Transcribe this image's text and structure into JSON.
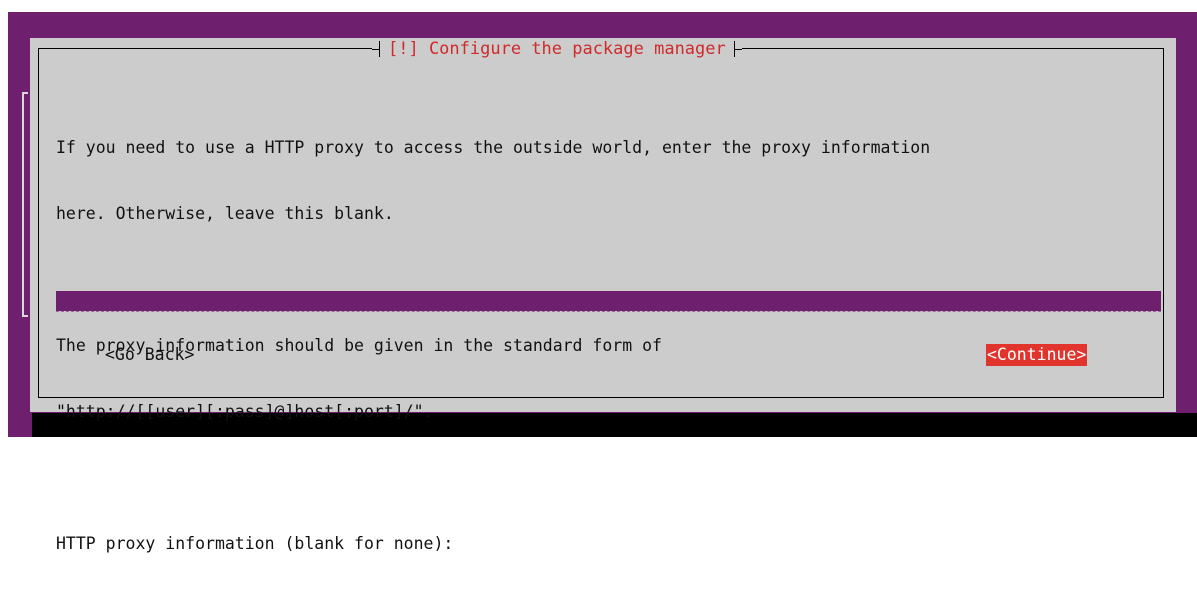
{
  "dialog": {
    "title": "[!] Configure the package manager",
    "paragraph1_line1": "If you need to use a HTTP proxy to access the outside world, enter the proxy information",
    "paragraph1_line2": "here. Otherwise, leave this blank.",
    "paragraph2_line1": "The proxy information should be given in the standard form of",
    "paragraph2_line2": "\"http://[[user][:pass]@]host[:port]/\".",
    "prompt": "HTTP proxy information (blank for none):",
    "proxy_value": ""
  },
  "buttons": {
    "back_label": "<Go Back>",
    "continue_label": "<Continue>"
  },
  "colors": {
    "background": "#6e1f6e",
    "dialog": "#cccccc",
    "title_text": "#d02a2a",
    "focused_button": "#e0342c"
  }
}
